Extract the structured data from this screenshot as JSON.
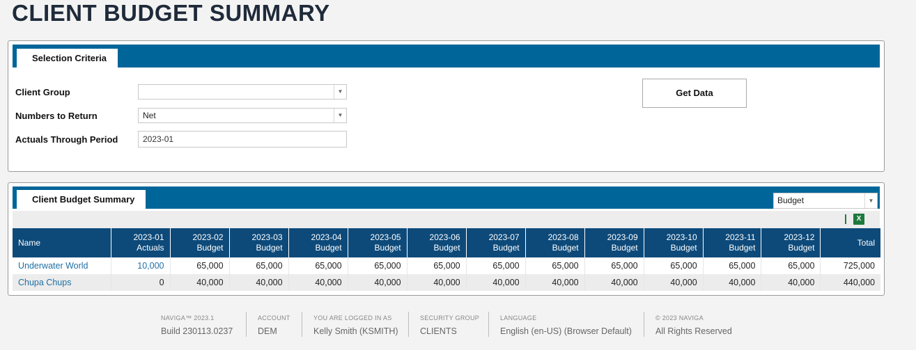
{
  "page_title": "CLIENT BUDGET SUMMARY",
  "criteria": {
    "tab_label": "Selection Criteria",
    "client_group_label": "Client Group",
    "client_group_value": "",
    "numbers_label": "Numbers to Return",
    "numbers_value": "Net",
    "actuals_label": "Actuals Through Period",
    "actuals_value": "2023-01",
    "get_data_label": "Get Data"
  },
  "summary": {
    "tab_label": "Client Budget Summary",
    "view_select_value": "Budget",
    "columns": [
      {
        "line1": "",
        "line2": "Name"
      },
      {
        "line1": "2023-01",
        "line2": "Actuals"
      },
      {
        "line1": "2023-02",
        "line2": "Budget"
      },
      {
        "line1": "2023-03",
        "line2": "Budget"
      },
      {
        "line1": "2023-04",
        "line2": "Budget"
      },
      {
        "line1": "2023-05",
        "line2": "Budget"
      },
      {
        "line1": "2023-06",
        "line2": "Budget"
      },
      {
        "line1": "2023-07",
        "line2": "Budget"
      },
      {
        "line1": "2023-08",
        "line2": "Budget"
      },
      {
        "line1": "2023-09",
        "line2": "Budget"
      },
      {
        "line1": "2023-10",
        "line2": "Budget"
      },
      {
        "line1": "2023-11",
        "line2": "Budget"
      },
      {
        "line1": "2023-12",
        "line2": "Budget"
      },
      {
        "line1": "",
        "line2": "Total"
      }
    ],
    "rows": [
      {
        "name": "Underwater World",
        "values": [
          "10,000",
          "65,000",
          "65,000",
          "65,000",
          "65,000",
          "65,000",
          "65,000",
          "65,000",
          "65,000",
          "65,000",
          "65,000",
          "65,000",
          "725,000"
        ]
      },
      {
        "name": "Chupa Chups",
        "values": [
          "0",
          "40,000",
          "40,000",
          "40,000",
          "40,000",
          "40,000",
          "40,000",
          "40,000",
          "40,000",
          "40,000",
          "40,000",
          "40,000",
          "440,000"
        ]
      }
    ]
  },
  "footer": [
    {
      "caption": "NAVIGA™ 2023.1",
      "value": "Build 230113.0237"
    },
    {
      "caption": "ACCOUNT",
      "value": "DEM"
    },
    {
      "caption": "YOU ARE LOGGED IN AS",
      "value": "Kelly Smith (KSMITH)"
    },
    {
      "caption": "SECURITY GROUP",
      "value": "CLIENTS"
    },
    {
      "caption": "LANGUAGE",
      "value": "English (en-US) (Browser Default)"
    },
    {
      "caption": "© 2023 NAVIGA",
      "value": "All Rights Reserved"
    }
  ],
  "colors": {
    "header_blue": "#006699",
    "grid_header": "#0d4a7a",
    "link": "#1f6fa5"
  }
}
